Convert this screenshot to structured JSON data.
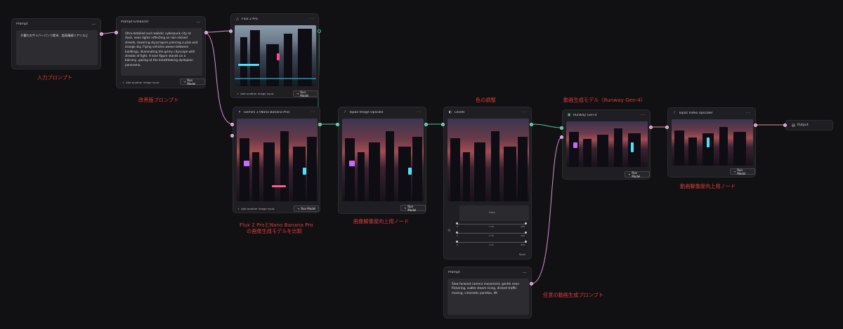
{
  "nodes": {
    "prompt": {
      "title": "Prompt",
      "text": "夕暮れのサイバーパンク都市、超高精細リアリスビ"
    },
    "enhancer": {
      "title": "Prompt Enhancer",
      "text": "Ultra-detailed and realistic cyberpunk city at dusk, neon lights reflecting on rain-slicked streets, towering skyscrapers piercing a pink and orange sky. Flying vehicles weave between buildings, illuminating the grimy cityscape with streaks of light. A lone figure stands on a balcony, gazing at the breathtaking dystopian panorama.",
      "add_input": "Add another image input",
      "run": "Run Model"
    },
    "flux": {
      "title": "Flux 2 Pro",
      "add_input": "Add another image input",
      "run": "Run Model"
    },
    "gemini": {
      "title": "Gemini 3 (Nano Banana Pro)",
      "add_input": "Add another image input",
      "run": "Run Model"
    },
    "topaz_img": {
      "title": "Topaz Image Upscale",
      "run": "Run Model"
    },
    "levels": {
      "title": "Levels",
      "panel_label": "Histo",
      "reset": "Reset",
      "sliders": [
        {
          "l": "0",
          "m": "1.00",
          "r": "255"
        },
        {
          "l": "0",
          "m": "0.70",
          "r": "255"
        },
        {
          "l": "0",
          "m": "1.07",
          "r": "255"
        }
      ]
    },
    "runway": {
      "title": "Runway Gen-4",
      "run": "Run Model"
    },
    "topaz_vid": {
      "title": "Topaz Video Upscaler",
      "run": "Run Model"
    },
    "output": {
      "title": "Output"
    },
    "prompt2": {
      "title": "Prompt",
      "text": "Slow forward camera movement, gentle neon flickering, subtle steam rising, distant traffic moving, cinematic parallax, 4K"
    }
  },
  "annotations": {
    "input_prompt": "入力プロンプト",
    "improved_prompt": "改善版プロンプト",
    "compare_line1": "Flux 2 ProとNano Banana Pro",
    "compare_line2": "の画像生成モデルを比較",
    "image_upscale": "画像解像度向上用ノード",
    "color_adjust": "色の調整",
    "video_model": "動画生成モデル（Runway Gen-4）",
    "video_upscale": "動画解像度向上用ノード",
    "video_prompt": "任意の動画生成プロンプト"
  },
  "colors": {
    "wire_pink": "#d98fd3",
    "wire_green": "#47c89c",
    "annotation": "#e23b3b"
  }
}
